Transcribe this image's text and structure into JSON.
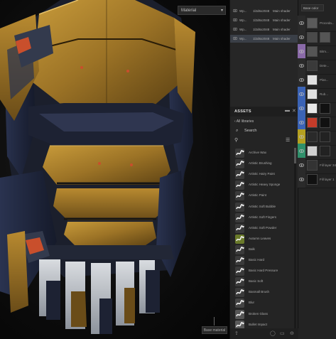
{
  "viewport": {
    "dropdown_label": "Material",
    "bottom_button_label": "Base material"
  },
  "texture_sets": {
    "rows": [
      {
        "col1": "Wp...",
        "col2": "1l2d6x2048",
        "col3": "Main shader",
        "selected": false
      },
      {
        "col1": "Wp...",
        "col2": "1l2d6x2048",
        "col3": "Main shader",
        "selected": false
      },
      {
        "col1": "Wp...",
        "col2": "1l2d6x2048",
        "col3": "Main shader",
        "selected": false
      },
      {
        "col1": "Wp...",
        "col2": "1l2d6x2048",
        "col3": "Main shader",
        "selected": true
      }
    ]
  },
  "layers": {
    "blend_mode": "Base color",
    "rows": [
      {
        "label": "Proceda...",
        "tag_color": "#2a2a2a",
        "thumb": "#5a5a5a",
        "thumb2": ""
      },
      {
        "label": "",
        "tag_color": "#2a2a2a",
        "thumb": "#4a4a4a",
        "thumb2": "#555555"
      },
      {
        "label": "Bitm...",
        "tag_color": "#8a6aa8",
        "thumb": "#555555",
        "thumb2": ""
      },
      {
        "label": "Dete...",
        "tag_color": "#2a2a2a",
        "thumb": "#3a3a3a",
        "thumb2": ""
      },
      {
        "label": "Plas...",
        "tag_color": "#2a2a2a",
        "thumb": "#e0e0e0",
        "thumb2": ""
      },
      {
        "label": "Rub...",
        "tag_color": "#3b63b5",
        "thumb": "#e0e0e0",
        "thumb2": ""
      },
      {
        "label": "",
        "tag_color": "#3b63b5",
        "thumb": "#e8e8e8",
        "thumb2": "#111111"
      },
      {
        "label": "",
        "tag_color": "#3b63b5",
        "thumb": "#c43c2a",
        "thumb2": "#111111"
      },
      {
        "label": "",
        "tag_color": "#b5a020",
        "thumb": "#2a2a2a",
        "thumb2": "#222222"
      },
      {
        "label": "",
        "tag_color": "#2f8f6a",
        "thumb": "#cfcfcf",
        "thumb2": "#222222"
      },
      {
        "label": "Fill layer 34",
        "tag_color": "#2a2a2a",
        "thumb": "#333333",
        "thumb2": ""
      },
      {
        "label": "Fill layer 1",
        "tag_color": "#2a2a2a",
        "thumb": "#111111",
        "thumb2": ""
      }
    ]
  },
  "assets": {
    "title": "ASSETS",
    "library": "All libraries",
    "search_placeholder": "Search",
    "items": [
      {
        "name": "Archive Wax",
        "icon": "brush-icon"
      },
      {
        "name": "Artistic Brushing",
        "icon": "brush-icon"
      },
      {
        "name": "Artistic Hairy Paint",
        "icon": "brush-icon"
      },
      {
        "name": "Artistic Heavy Sponge",
        "icon": "brush-icon"
      },
      {
        "name": "Artistic Paint",
        "icon": "brush-icon"
      },
      {
        "name": "Artistic Soft Bubble",
        "icon": "brush-icon"
      },
      {
        "name": "Artistic Soft Fingers",
        "icon": "brush-icon"
      },
      {
        "name": "Artistic Soft Powder",
        "icon": "brush-icon"
      },
      {
        "name": "Autumn Leaves",
        "icon": "leaf-icon"
      },
      {
        "name": "Balk",
        "icon": "brush-icon"
      },
      {
        "name": "Basic Hard",
        "icon": "brush-icon"
      },
      {
        "name": "Basic Hard Pressure",
        "icon": "brush-icon"
      },
      {
        "name": "Basic Soft",
        "icon": "brush-icon"
      },
      {
        "name": "Basmall Brush",
        "icon": "brush-icon"
      },
      {
        "name": "Blur",
        "icon": "blur-icon"
      },
      {
        "name": "Broken Glass",
        "icon": "glass-icon"
      },
      {
        "name": "Bullet Impact",
        "icon": "impact-icon"
      }
    ]
  }
}
